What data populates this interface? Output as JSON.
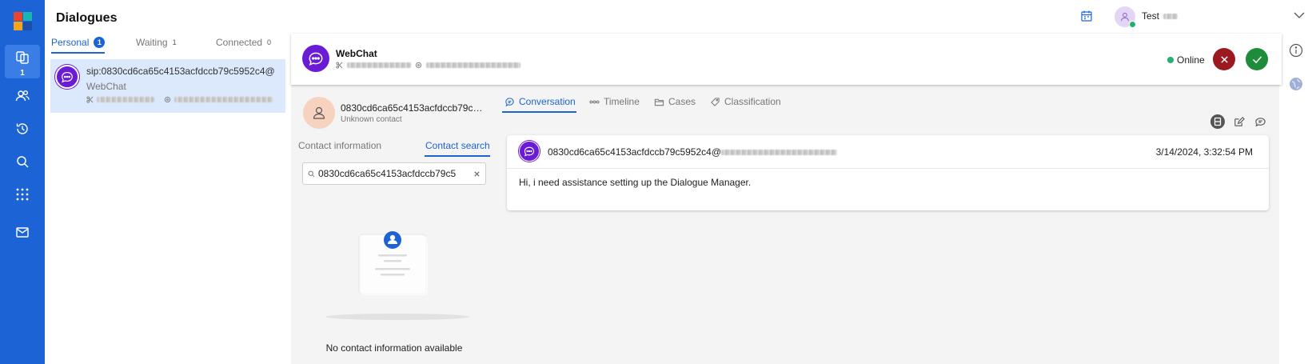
{
  "app": {
    "title": "Dialogues"
  },
  "nav": {
    "items": [
      {
        "name": "dialogues",
        "icon": "copy-icon",
        "badge": "1"
      },
      {
        "name": "contacts",
        "icon": "users-icon"
      },
      {
        "name": "history",
        "icon": "history-icon"
      },
      {
        "name": "search",
        "icon": "search-icon"
      },
      {
        "name": "apps",
        "icon": "grid-icon"
      },
      {
        "name": "mail",
        "icon": "mail-icon"
      }
    ]
  },
  "header": {
    "user_name": "Test"
  },
  "tabs": [
    {
      "label": "Personal",
      "count": "1"
    },
    {
      "label": "Waiting",
      "count": "1"
    },
    {
      "label": "Connected",
      "count": "0"
    }
  ],
  "dialogue": {
    "title": "sip:0830cd6ca65c4153acfdccb79c5952c4@",
    "channel": "WebChat"
  },
  "conversation_header": {
    "title": "WebChat",
    "status": "Online"
  },
  "contact": {
    "name": "0830cd6ca65c4153acfdccb79c5952c4",
    "subtitle": "Unknown contact"
  },
  "content_tabs": [
    "Conversation",
    "Timeline",
    "Cases",
    "Classification"
  ],
  "side_tabs": [
    "Contact information",
    "Contact search"
  ],
  "search": {
    "value": "0830cd6ca65c4153acfdccb79c5"
  },
  "empty_state": {
    "text": "No contact information available"
  },
  "message": {
    "from": "0830cd6ca65c4153acfdccb79c5952c4@",
    "time": "3/14/2024, 3:32:54 PM",
    "body": "Hi, i need assistance setting up the Dialogue Manager."
  },
  "colors": {
    "nav_bg": "#1c63d6",
    "accent": "#1c63d6",
    "online": "#23b26d",
    "reject": "#9c1a1f",
    "accept": "#1f8c3b",
    "webchat": "#6a1bd6"
  }
}
